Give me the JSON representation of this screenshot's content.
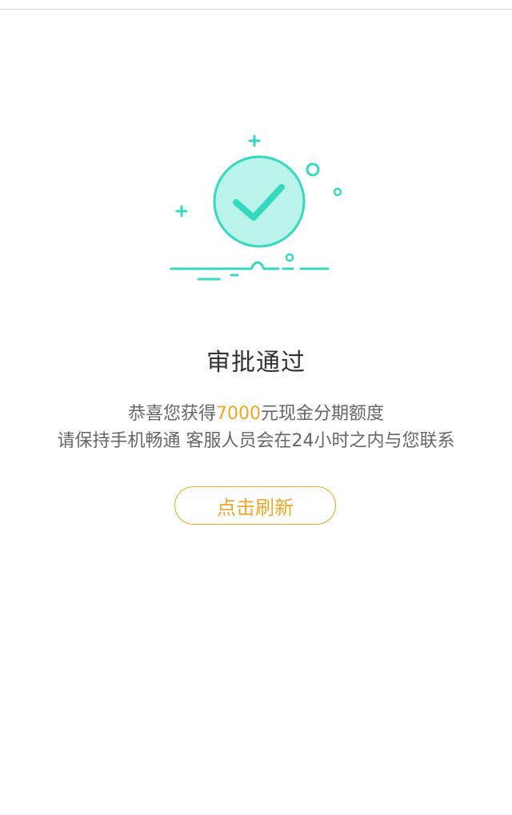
{
  "status": {
    "title": "审批通过",
    "message_line1_prefix": "恭喜您获得",
    "amount": "7000",
    "message_line1_suffix": "元现金分期额度",
    "message_line2": "请保持手机畅通 客服人员会在24小时之内与您联系"
  },
  "actions": {
    "refresh_label": "点击刷新"
  },
  "colors": {
    "accent": "#f2a623",
    "success": "#35d9c0",
    "success_fill": "#b9f3ea"
  },
  "icons": {
    "status": "check-circle-icon"
  }
}
